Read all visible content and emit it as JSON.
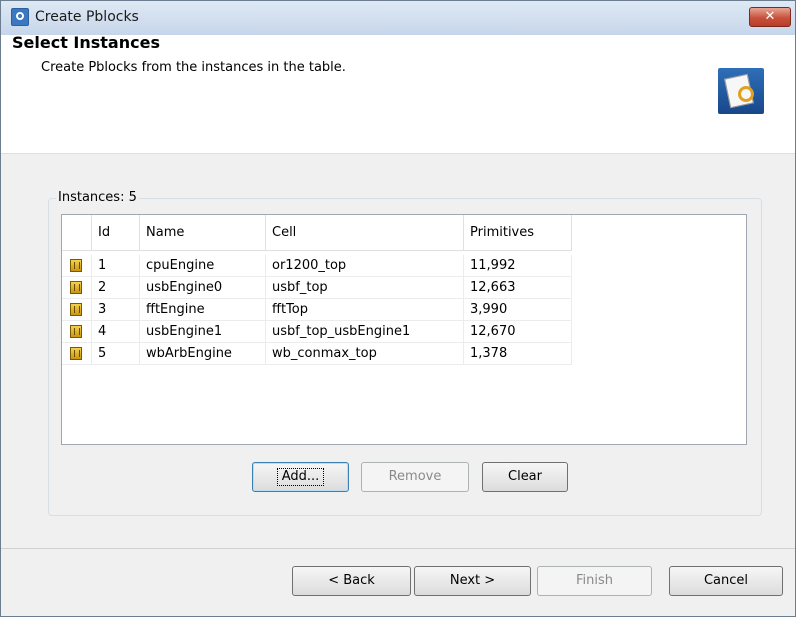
{
  "window": {
    "title": "Create Pblocks"
  },
  "header": {
    "title": "Select Instances",
    "subtitle": "Create Pblocks from the instances in the table."
  },
  "instances": {
    "label": "Instances: 5",
    "columns": [
      "",
      "Id",
      "Name",
      "Cell",
      "Primitives"
    ],
    "rows": [
      {
        "id": "1",
        "name": "cpuEngine",
        "cell": "or1200_top",
        "primitives": "11,992"
      },
      {
        "id": "2",
        "name": "usbEngine0",
        "cell": "usbf_top",
        "primitives": "12,663"
      },
      {
        "id": "3",
        "name": "fftEngine",
        "cell": "fftTop",
        "primitives": "3,990"
      },
      {
        "id": "4",
        "name": "usbEngine1",
        "cell": "usbf_top_usbEngine1",
        "primitives": "12,670"
      },
      {
        "id": "5",
        "name": "wbArbEngine",
        "cell": "wb_conmax_top",
        "primitives": "1,378"
      }
    ]
  },
  "table_buttons": {
    "add": "Add...",
    "remove": "Remove",
    "clear": "Clear"
  },
  "footer_buttons": {
    "back": "< Back",
    "next": "Next >",
    "finish": "Finish",
    "cancel": "Cancel"
  },
  "colors": {
    "accent": "#3c7fb1",
    "close_button": "#c8513b",
    "instance_icon": "#e0b030"
  },
  "icons": {
    "app": "vivado-logo-icon",
    "header": "pblock-wizard-icon",
    "row": "instance-icon",
    "close": "close-icon"
  }
}
